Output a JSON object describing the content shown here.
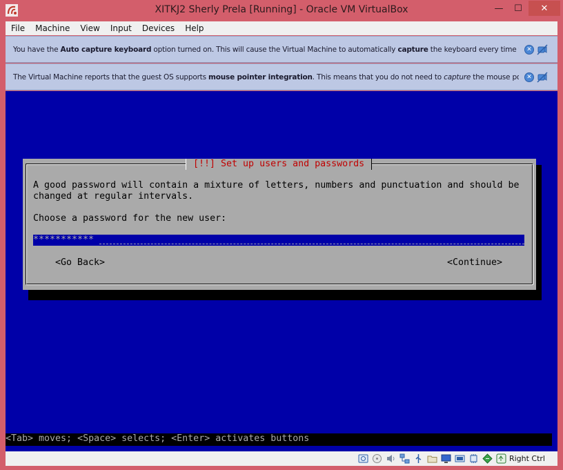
{
  "window": {
    "title": "XITKJ2 Sherly Prela [Running] - Oracle VM VirtualBox",
    "minimize_glyph": "—",
    "maximize_glyph": "☐",
    "close_glyph": "✕"
  },
  "menubar": {
    "items": [
      "File",
      "Machine",
      "View",
      "Input",
      "Devices",
      "Help"
    ]
  },
  "banners": {
    "keyboard": {
      "t1": "You have the ",
      "b1": "Auto capture keyboard",
      "t2": " option turned on. This will cause the Virtual Machine to automatically ",
      "b2": "capture",
      "t3": " the keyboard every time the VM"
    },
    "mouse": {
      "t1": "The Virtual Machine reports that the guest OS supports ",
      "b1": "mouse pointer integration",
      "t2": ". This means that you do not need to ",
      "i1": "capture",
      "t3": " the mouse pointer"
    },
    "close_glyph": "✕"
  },
  "installer": {
    "title": "[!!] Set up users and passwords",
    "message": "A good password will contain a mixture of letters, numbers and punctuation and should be\nchanged at regular intervals.",
    "prompt": "Choose a password for the new user:",
    "password_value": "***********",
    "go_back": "<Go Back>",
    "continue": "<Continue>",
    "help_line": "<Tab> moves; <Space> selects; <Enter> activates buttons"
  },
  "statusbar": {
    "icons": [
      "hard-disk-icon",
      "optical-drive-icon",
      "audio-icon",
      "network-icon",
      "usb-icon",
      "shared-folders-icon",
      "display-icon",
      "video-capture-icon",
      "cpu-icon",
      "mouse-integration-icon",
      "host-key-icon"
    ],
    "host_key": "Right Ctrl"
  },
  "colors": {
    "titlebar": "#d35e6b",
    "vm_background": "#0000a8",
    "dialog_background": "#aaaaaa",
    "dialog_title": "#c00000",
    "banner": "#bdc8e4"
  }
}
